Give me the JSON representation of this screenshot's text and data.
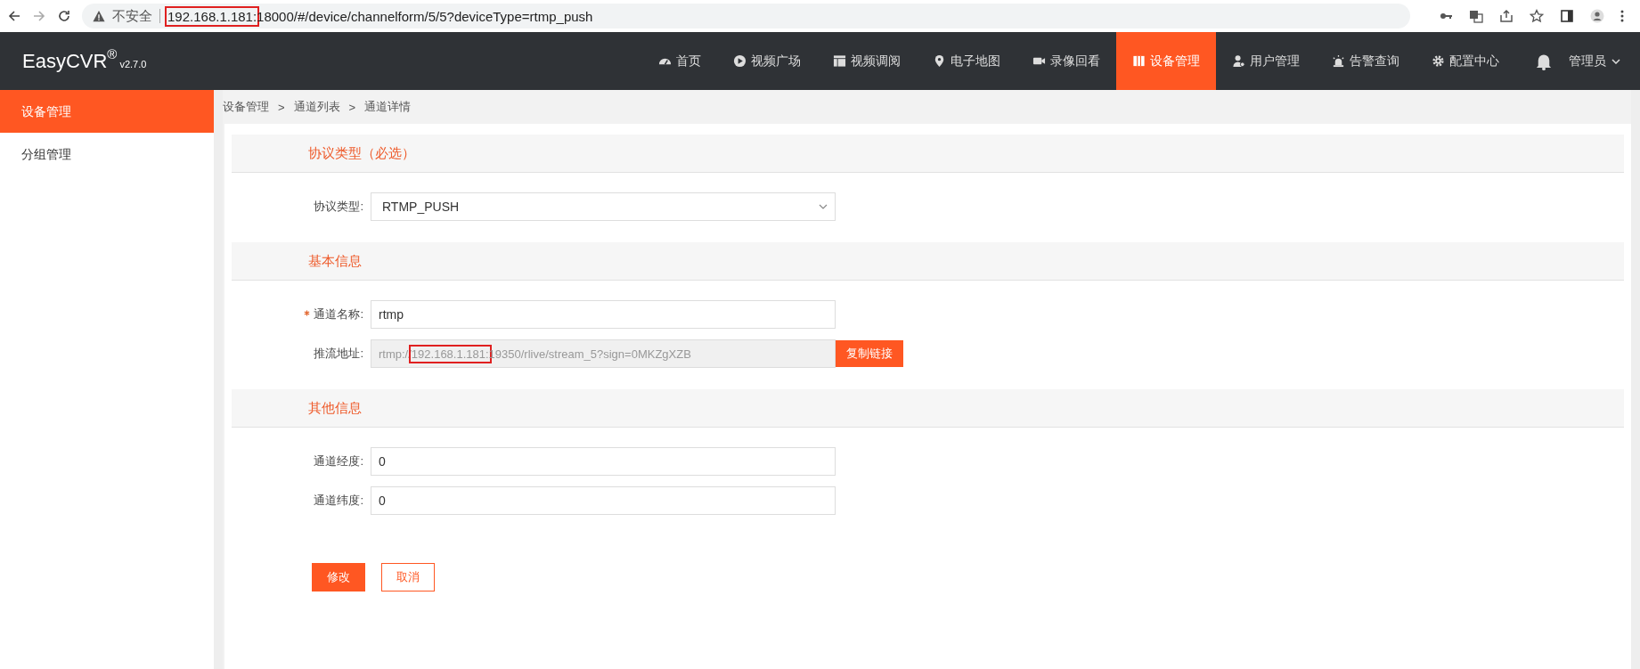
{
  "browser": {
    "security": "不安全",
    "url": [
      {
        "text": "192.168.1.181:",
        "highlighted": true
      },
      {
        "text": "18000/#/device/channelform/5/5?deviceType=rtmp_push",
        "highlighted": false
      }
    ]
  },
  "header": {
    "logo": "EasyCVR",
    "logo_mark": "®",
    "version": "v2.7.0",
    "nav": [
      {
        "label": "首页",
        "selected": false
      },
      {
        "label": "视频广场",
        "selected": false
      },
      {
        "label": "视频调阅",
        "selected": false
      },
      {
        "label": "电子地图",
        "selected": false
      },
      {
        "label": "录像回看",
        "selected": false
      },
      {
        "label": "设备管理",
        "selected": true
      },
      {
        "label": "用户管理",
        "selected": false
      },
      {
        "label": "告警查询",
        "selected": false
      },
      {
        "label": "配置中心",
        "selected": false
      }
    ],
    "user": "管理员"
  },
  "sidebar": {
    "items": [
      {
        "label": "设备管理",
        "selected": true
      },
      {
        "label": "分组管理",
        "selected": false
      }
    ]
  },
  "breadcrumb": [
    {
      "label": "设备管理"
    },
    {
      "separator": ">",
      "label": "通道列表"
    },
    {
      "separator": ">",
      "label": "通道详情"
    }
  ],
  "sections": [
    {
      "title": "协议类型（必选）",
      "fields": [
        {
          "kind": "select",
          "label": "协议类型:",
          "value": "RTMP_PUSH",
          "required": false
        }
      ]
    },
    {
      "title": "基本信息",
      "fields": [
        {
          "kind": "input",
          "label": "通道名称:",
          "value": "rtmp",
          "required": true
        },
        {
          "kind": "copy",
          "label": "推流地址:",
          "parts": [
            {
              "text": "rtmp://",
              "highlighted": false
            },
            {
              "text": "192.168.1.181:",
              "highlighted": true
            },
            {
              "text": "19350/rlive/stream_5?sign=0MKZgXZB",
              "highlighted": false
            }
          ],
          "button": "复制链接"
        }
      ]
    },
    {
      "title": "其他信息",
      "fields": [
        {
          "kind": "input",
          "label": "通道经度:",
          "value": "0",
          "required": false
        },
        {
          "kind": "input",
          "label": "通道纬度:",
          "value": "0",
          "required": false
        }
      ]
    }
  ],
  "actions": [
    {
      "label": "修改",
      "kind": "primary"
    },
    {
      "label": "取消",
      "kind": "secondary"
    }
  ]
}
